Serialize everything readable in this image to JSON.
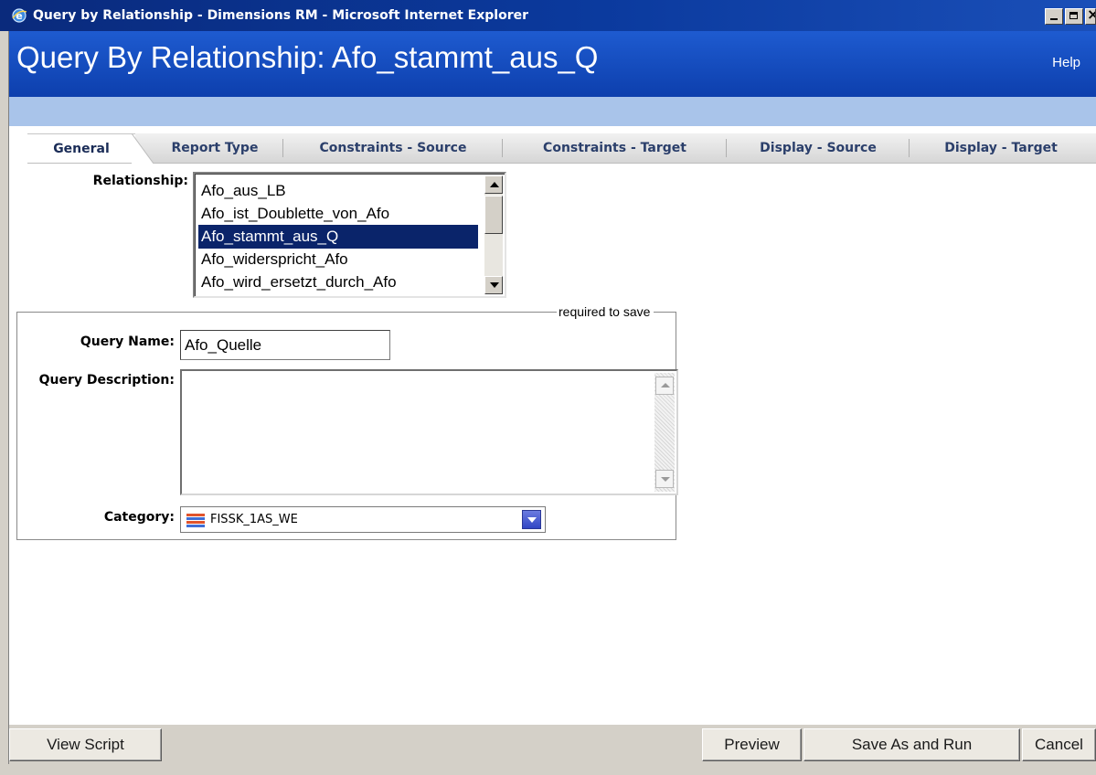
{
  "window": {
    "title": "Query by Relationship - Dimensions RM - Microsoft Internet Explorer"
  },
  "header": {
    "title": "Query By Relationship: Afo_stammt_aus_Q",
    "help_label": "Help"
  },
  "tabs": [
    {
      "label": "General",
      "active": true
    },
    {
      "label": "Report Type",
      "active": false
    },
    {
      "label": "Constraints - Source",
      "active": false
    },
    {
      "label": "Constraints - Target",
      "active": false
    },
    {
      "label": "Display - Source",
      "active": false
    },
    {
      "label": "Display - Target",
      "active": false
    }
  ],
  "relationship": {
    "label": "Relationship:",
    "items": [
      "Afo_aus_LB",
      "Afo_ist_Doublette_von_Afo",
      "Afo_stammt_aus_Q",
      "Afo_widerspricht_Afo",
      "Afo_wird_ersetzt_durch_Afo"
    ],
    "selected": "Afo_stammt_aus_Q"
  },
  "form": {
    "required_note": "required to save",
    "query_name_label": "Query Name:",
    "query_name_value": "Afo_Quelle",
    "query_description_label": "Query Description:",
    "query_description_value": "",
    "category_label": "Category:",
    "category_value": "FISSK_1AS_WE"
  },
  "buttons": {
    "view_script": "View Script",
    "preview": "Preview",
    "save_as_and_run": "Save As and Run",
    "cancel": "Cancel"
  },
  "colors": {
    "title_bar": "#0b3a9e",
    "header": "#1e5bd0",
    "light_band": "#a9c4ea",
    "selection": "#0a246a"
  }
}
